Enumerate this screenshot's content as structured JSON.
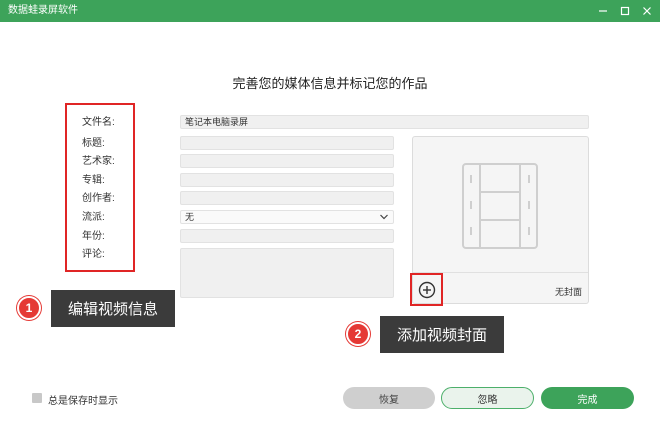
{
  "window": {
    "title": "数据蛙录屏软件",
    "accent": "#3da35a"
  },
  "heading": "完善您的媒体信息并标记您的作品",
  "form": {
    "labels": {
      "filename": "文件名:",
      "title": "标题:",
      "artist": "艺术家:",
      "album": "专辑:",
      "composer": "创作者:",
      "genre": "流派:",
      "year": "年份:",
      "comment": "评论:"
    },
    "values": {
      "filename": "笔记本电脑录屏",
      "genre": "无"
    }
  },
  "cover": {
    "no_cover_text": "无封面",
    "add_icon": "plus-circle-icon",
    "placeholder_icon": "film-strip-icon"
  },
  "callouts": [
    {
      "number": "1",
      "label": "编辑视频信息"
    },
    {
      "number": "2",
      "label": "添加视频封面"
    }
  ],
  "footer": {
    "always_show_label": "总是保存时显示",
    "restore": "恢复",
    "ignore": "忽略",
    "done": "完成"
  },
  "colors": {
    "highlight_red": "#e02525",
    "callout_bg": "#3b3b3b"
  }
}
